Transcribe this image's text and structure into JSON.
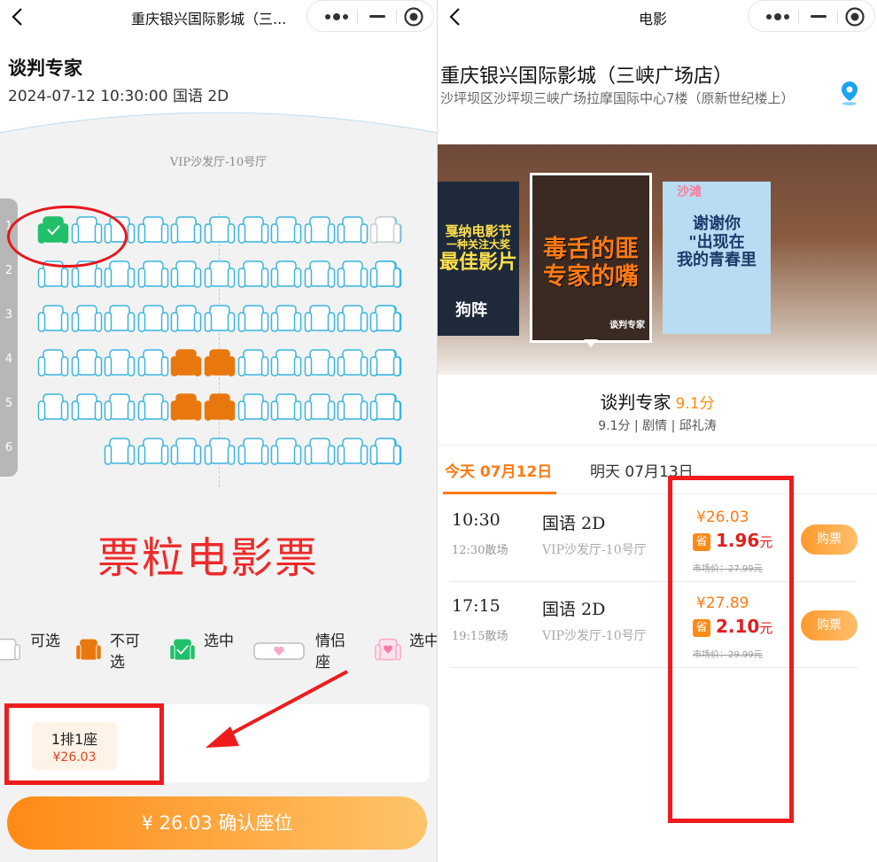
{
  "left": {
    "topbar_title": "重庆银兴国际影城（三...",
    "movie_name": "谈判专家",
    "movie_meta": "2024-07-12 10:30:00 国语 2D",
    "hall_name": "VIP沙发厅-10号厅",
    "row_numbers": [
      "1",
      "2",
      "3",
      "4",
      "5",
      "6"
    ],
    "seat_rows": [
      [
        "selected",
        "avail",
        "avail",
        "avail",
        "avail",
        "avail",
        "avail",
        "avail",
        "avail",
        "avail",
        "avail",
        "unavail-grey"
      ],
      [
        "avail",
        "avail",
        "avail",
        "avail",
        "avail",
        "avail",
        "avail",
        "avail",
        "avail",
        "avail",
        "avail",
        "avail"
      ],
      [
        "avail",
        "avail",
        "avail",
        "avail",
        "avail",
        "avail",
        "avail",
        "avail",
        "avail",
        "avail",
        "avail",
        "avail"
      ],
      [
        "avail",
        "avail",
        "avail",
        "avail",
        "sold",
        "sold",
        "avail",
        "avail",
        "avail",
        "avail",
        "avail",
        "avail"
      ],
      [
        "avail",
        "avail",
        "avail",
        "avail",
        "sold",
        "sold",
        "avail",
        "avail",
        "avail",
        "avail",
        "avail",
        "avail"
      ],
      [
        "none",
        "none",
        "avail",
        "avail",
        "avail",
        "avail",
        "avail",
        "avail",
        "avail",
        "avail",
        "avail",
        "avail"
      ]
    ],
    "watermark": "票粒电影票",
    "legend": [
      {
        "label": "可选",
        "icon": "available-seat-icon"
      },
      {
        "label": "不可选",
        "icon": "sold-seat-icon"
      },
      {
        "label": "选中",
        "icon": "selected-seat-icon"
      },
      {
        "label": "情侣座",
        "icon": "couple-seat-icon"
      },
      {
        "label": "选中",
        "icon": "couple-selected-seat-icon"
      }
    ],
    "selected_seat": "1排1座",
    "selected_price": "¥26.03",
    "confirm_label": "¥ 26.03 确认座位"
  },
  "right": {
    "topbar_title": "电影",
    "cinema_name": "重庆银兴国际影城（三峡广场店）",
    "cinema_address": "沙坪坝区沙坪坝三峡广场拉摩国际中心7楼（原新世纪楼上）",
    "posters": [
      {
        "lines": [
          "戛纳电影节",
          "一种关注大奖",
          "最佳影片"
        ],
        "sub": "狗阵"
      },
      {
        "lines": [
          "毒舌的匪",
          "专家的嘴"
        ],
        "sub": "谈判专家"
      },
      {
        "lines": [
          "谢谢你",
          "\"出现在",
          "我的青春里"
        ],
        "sub": "沙滩"
      }
    ],
    "movie_title": "谈判专家",
    "movie_score": "9.1分",
    "movie_sub": "9.1分 | 剧情 | 邱礼涛",
    "tabs": [
      {
        "label": "今天 07月12日",
        "active": true
      },
      {
        "label": "明天 07月13日",
        "active": false
      }
    ],
    "showtimes": [
      {
        "time": "10:30",
        "end": "12:30散场",
        "lang": "国语 2D",
        "hall": "VIP沙发厅-10号厅",
        "price": "¥26.03",
        "save_badge": "省",
        "save": "1.96",
        "save_unit": "元",
        "market": "市场价：27.99元",
        "buy": "购票"
      },
      {
        "time": "17:15",
        "end": "19:15散场",
        "lang": "国语 2D",
        "hall": "VIP沙发厅-10号厅",
        "price": "¥27.89",
        "save_badge": "省",
        "save": "2.10",
        "save_unit": "元",
        "market": "市场价：29.99元",
        "buy": "购票"
      }
    ]
  },
  "colors": {
    "accent_orange": "#ff7a14",
    "seat_available": "#3ab4e0",
    "seat_sold": "#e8780e",
    "seat_selected": "#20c06a",
    "annotation_red": "#ee1c1c"
  }
}
